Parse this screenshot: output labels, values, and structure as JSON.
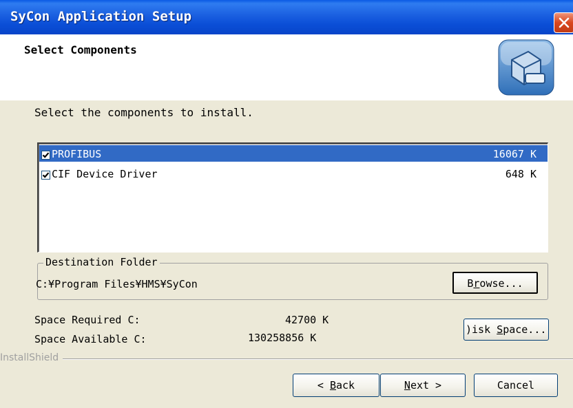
{
  "window": {
    "title": "SyCon Application Setup"
  },
  "header": {
    "title": "Select Components",
    "icon": "setup-computer-icon"
  },
  "instruction": "Select the components to install.",
  "components": [
    {
      "name": "PROFIBUS",
      "size": "16067 K",
      "checked": true,
      "selected": true
    },
    {
      "name": "CIF Device Driver",
      "size": "648 K",
      "checked": true,
      "selected": false
    }
  ],
  "destination": {
    "legend": "Destination Folder",
    "path": "C:¥Program Files¥HMS¥SyCon",
    "browse_pre": "B",
    "browse_ul": "r",
    "browse_post": "owse..."
  },
  "space": {
    "required_label": "Space Required  C:",
    "required_value": "42700 K",
    "available_label": "Space Available C:",
    "available_value": "130258856 K",
    "disk_pre": ")isk ",
    "disk_ul": "S",
    "disk_post": "pace..."
  },
  "footer": {
    "brand": "InstallShield",
    "back_pre": "< ",
    "back_ul": "B",
    "back_post": "ack",
    "next_ul": "N",
    "next_post": "ext >",
    "cancel": "Cancel"
  }
}
